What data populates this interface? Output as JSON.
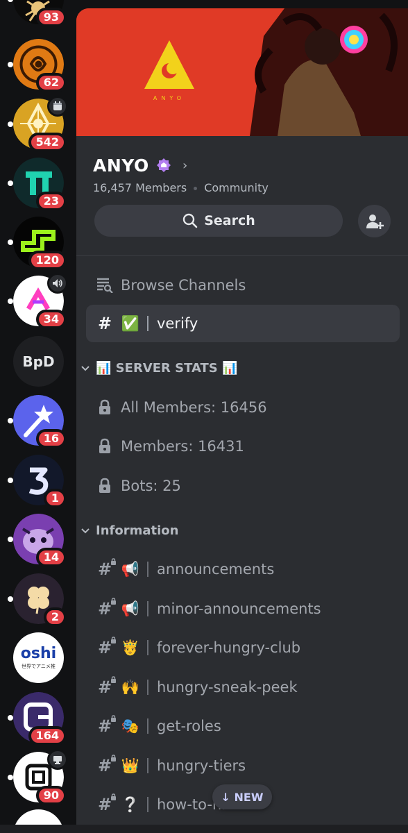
{
  "servers": [
    {
      "name": "server-spider",
      "badge": "93"
    },
    {
      "name": "server-gold-emblem",
      "badge": "62"
    },
    {
      "name": "server-gold-pattern",
      "badge": "542",
      "mini_icon": "calendar-icon"
    },
    {
      "name": "server-teal-pi",
      "badge": "23"
    },
    {
      "name": "server-green-wave",
      "badge": "120"
    },
    {
      "name": "server-pink-logo",
      "badge": "34",
      "mini_icon": "speaker-icon"
    },
    {
      "name": "server-bpd",
      "label": "BpD"
    },
    {
      "name": "server-star-wand",
      "badge": "16"
    },
    {
      "name": "server-three",
      "badge": "1"
    },
    {
      "name": "server-purple-creature",
      "badge": "14"
    },
    {
      "name": "server-clover",
      "badge": "2"
    },
    {
      "name": "server-oshi",
      "label": "oshi",
      "sublabel": "世界でアニメ推"
    },
    {
      "name": "server-g-cube",
      "badge": "164"
    },
    {
      "name": "server-square-logo",
      "badge": "90",
      "mini_icon": "monitor-icon"
    }
  ],
  "banner": {
    "logo_text": "ANYO"
  },
  "guild": {
    "name": "ANYO",
    "members": "16,457 Members",
    "type": "Community"
  },
  "actions": {
    "search_label": "Search"
  },
  "browse": {
    "label": "Browse Channels"
  },
  "verify": {
    "label": "verify",
    "emoji": "✅"
  },
  "categories": {
    "stats": {
      "label": "📊 SERVER STATS 📊"
    },
    "information": {
      "label": "Information"
    }
  },
  "stats_channels": [
    {
      "label": "All Members: 16456"
    },
    {
      "label": "Members: 16431"
    },
    {
      "label": "Bots: 25"
    }
  ],
  "info_channels": [
    {
      "label": "announcements",
      "emoji": "📢"
    },
    {
      "label": "minor-announcements",
      "emoji": "📢"
    },
    {
      "label": "forever-hungry-club",
      "emoji": "🤴"
    },
    {
      "label": "hungry-sneak-peek",
      "emoji": "🙌"
    },
    {
      "label": "get-roles",
      "emoji": "🎭"
    },
    {
      "label": "hungry-tiers",
      "emoji": "👑"
    },
    {
      "label": "how-to-hi",
      "emoji": "❔"
    }
  ],
  "new_pill": {
    "label": "↓ NEW"
  },
  "colors": {
    "badge": "#e34046",
    "panel": "#2b2d31",
    "rail": "#111214",
    "banner": "#e03a26",
    "logo_yellow": "#f2d21b"
  }
}
